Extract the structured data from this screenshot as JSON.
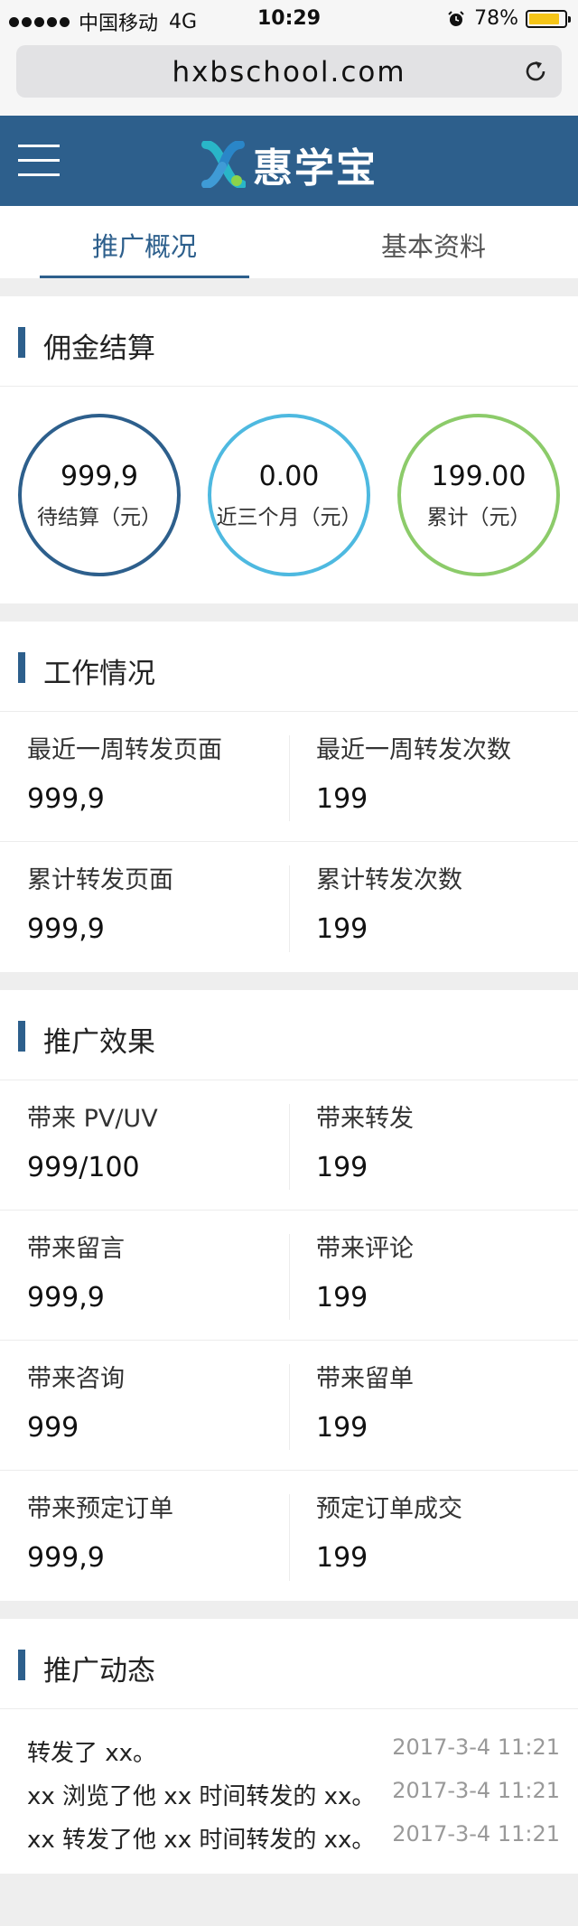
{
  "status_bar": {
    "carrier": "中国移动",
    "network": "4G",
    "time": "10:29",
    "battery_text": "78%",
    "battery_level": 0.78
  },
  "browser": {
    "url": "hxbschool.com"
  },
  "header": {
    "brand": "惠学宝"
  },
  "tabs": [
    {
      "label": "推广概况",
      "active": true
    },
    {
      "label": "基本资料",
      "active": false
    }
  ],
  "commission": {
    "title": "佣金结算",
    "items": [
      {
        "value": "999,9",
        "label": "待结算（元）",
        "color": "#2d5f8c"
      },
      {
        "value": "0.00",
        "label": "近三个月（元）",
        "color": "#4eb9e0"
      },
      {
        "value": "199.00",
        "label": "累计（元）",
        "color": "#8ccb6a"
      }
    ]
  },
  "work": {
    "title": "工作情况",
    "rows": [
      [
        {
          "label": "最近一周转发页面",
          "value": "999,9"
        },
        {
          "label": "最近一周转发次数",
          "value": "199"
        }
      ],
      [
        {
          "label": "累计转发页面",
          "value": "999,9"
        },
        {
          "label": "累计转发次数",
          "value": "199"
        }
      ]
    ]
  },
  "effect": {
    "title": "推广效果",
    "rows": [
      [
        {
          "label": "带来 PV/UV",
          "value": "999/100"
        },
        {
          "label": "带来转发",
          "value": "199"
        }
      ],
      [
        {
          "label": "带来留言",
          "value": "999,9"
        },
        {
          "label": "带来评论",
          "value": "199"
        }
      ],
      [
        {
          "label": "带来咨询",
          "value": "999"
        },
        {
          "label": "带来留单",
          "value": "199"
        }
      ],
      [
        {
          "label": "带来预定订单",
          "value": "999,9"
        },
        {
          "label": "预定订单成交",
          "value": "199"
        }
      ]
    ]
  },
  "activity": {
    "title": "推广动态",
    "items": [
      {
        "text": "转发了 xx。",
        "time": "2017-3-4 11:21"
      },
      {
        "text": "xx 浏览了他 xx 时间转发的 xx。",
        "time": "2017-3-4 11:21"
      },
      {
        "text": "xx 转发了他 xx 时间转发的 xx。",
        "time": "2017-3-4 11:21"
      }
    ]
  },
  "colors": {
    "primary": "#2d5f8c",
    "background": "#eeeeee"
  }
}
